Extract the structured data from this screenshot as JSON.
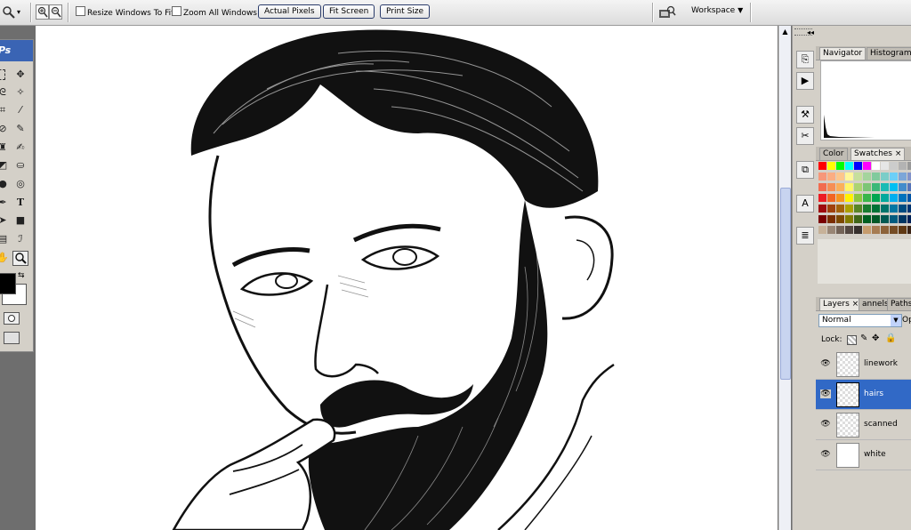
{
  "options_bar": {
    "tool_icon": "zoom-magnifier-icon",
    "resize_windows_to_fit": "Resize Windows To Fit",
    "zoom_all_windows": "Zoom All Windows",
    "actual_pixels": "Actual Pixels",
    "fit_screen": "Fit Screen",
    "print_size": "Print Size",
    "workspace": "Workspace"
  },
  "toolbox": {
    "logo": "Ps",
    "tools": [
      "marquee-icon",
      "move-icon",
      "lasso-icon",
      "magic-wand-icon",
      "crop-icon",
      "slice-icon",
      "healing-brush-icon",
      "brush-icon",
      "clone-stamp-icon",
      "history-brush-icon",
      "eraser-icon",
      "paint-bucket-icon",
      "blur-icon",
      "dodge-icon",
      "pen-icon",
      "type-icon",
      "path-selection-icon",
      "rectangle-shape-icon",
      "notes-icon",
      "eyedropper-icon",
      "hand-icon",
      "zoom-icon"
    ],
    "type_tool_glyph": "T"
  },
  "canvas": {
    "subject": "line-art-bearded-man"
  },
  "navigator_panel": {
    "tabs": [
      "Navigator",
      "Histogram"
    ]
  },
  "color_panel": {
    "tabs": [
      "Color",
      "Swatches ×"
    ],
    "swatch_rows": [
      [
        "#ff0000",
        "#ffff00",
        "#00ff00",
        "#00ffff",
        "#0000ff",
        "#ff00ff",
        "#ffffff",
        "#e6e6e6",
        "#cccccc",
        "#b3b3b3",
        "#999999"
      ],
      [
        "#f7977a",
        "#fbad82",
        "#fdc68c",
        "#fff799",
        "#c6df9c",
        "#a4d49d",
        "#81ca9d",
        "#7bcdc8",
        "#6ccff7",
        "#7ca6d8",
        "#8293ca"
      ],
      [
        "#f26c4f",
        "#f68e55",
        "#fbaf5a",
        "#fff467",
        "#acd372",
        "#7cc576",
        "#3bb878",
        "#1abbb4",
        "#00bff3",
        "#438ccb",
        "#5574b9"
      ],
      [
        "#ed1c24",
        "#f26522",
        "#f7941d",
        "#fff200",
        "#8dc63f",
        "#39b54a",
        "#00a651",
        "#00a99d",
        "#00aeef",
        "#0072bc",
        "#0054a6"
      ],
      [
        "#9e0b0f",
        "#a0410d",
        "#a36209",
        "#aba000",
        "#598527",
        "#197b30",
        "#007236",
        "#00746b",
        "#0076a3",
        "#004b80",
        "#003471"
      ],
      [
        "#790000",
        "#7b2e00",
        "#7d4900",
        "#827b00",
        "#406618",
        "#005e20",
        "#005826",
        "#005952",
        "#005b7f",
        "#003663",
        "#002157"
      ],
      [
        "#c7b299",
        "#998675",
        "#736357",
        "#534741",
        "#37302d",
        "#c69c6d",
        "#a67c52",
        "#8c6239",
        "#754c24",
        "#603913",
        "#3c2415"
      ]
    ]
  },
  "layers_panel": {
    "tabs": [
      "Layers ×",
      "annels",
      "Paths"
    ],
    "blend_mode": "Normal",
    "opacity_label": "Op",
    "lock_label": "Lock:",
    "layers": [
      {
        "name": "linework"
      },
      {
        "name": "hairs"
      },
      {
        "name": "scanned"
      },
      {
        "name": "white"
      }
    ]
  }
}
